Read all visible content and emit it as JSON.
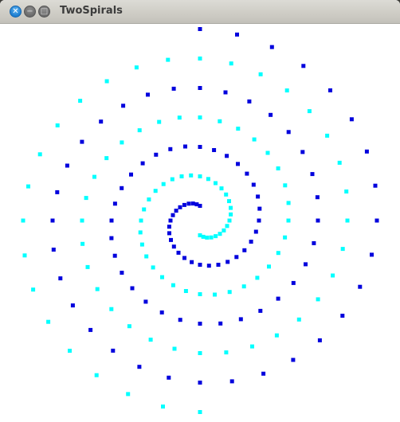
{
  "window": {
    "title": "TwoSpirals",
    "controls": {
      "close_icon": "close-icon",
      "minimize_icon": "minimize-icon",
      "maximize_icon": "maximize-icon"
    }
  },
  "chart_data": {
    "type": "scatter",
    "description_of_shape": "two interleaved Archimedean spirals",
    "series": [
      {
        "color": "#0000dd",
        "spiral_sign": 1
      },
      {
        "color": "#00ffff",
        "spiral_sign": -1
      }
    ],
    "points_per_spiral": 97
  }
}
